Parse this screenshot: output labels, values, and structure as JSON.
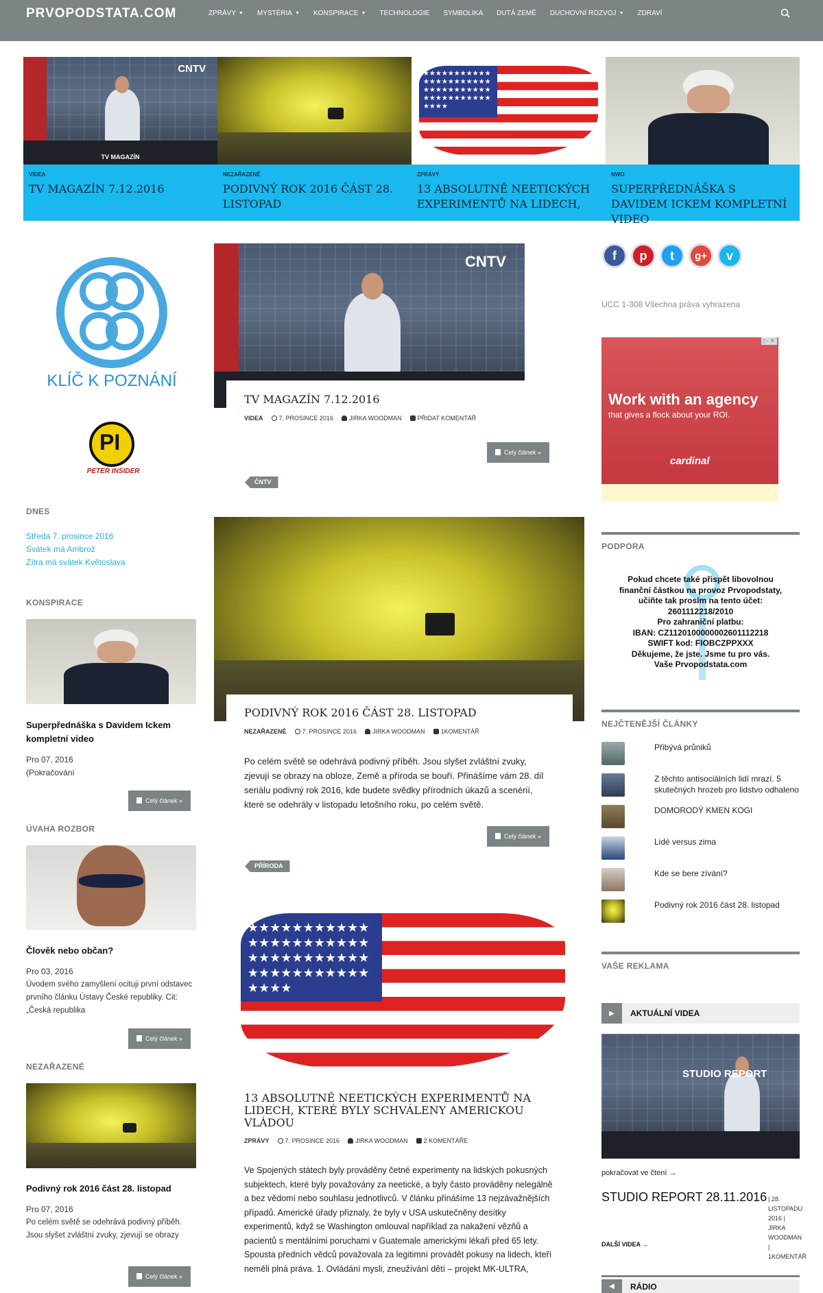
{
  "header": {
    "logo": "PRVOPODSTATA.COM",
    "nav": [
      {
        "label": "ZPRÁVY",
        "dropdown": true
      },
      {
        "label": "MYSTÉRIA",
        "dropdown": true
      },
      {
        "label": "KONSPIRACE",
        "dropdown": true
      },
      {
        "label": "TECHNOLOGIE",
        "dropdown": false
      },
      {
        "label": "SYMBOLIKA",
        "dropdown": false
      },
      {
        "label": "DUTÁ ZEMĚ",
        "dropdown": false
      },
      {
        "label": "DUCHOVNÍ ROZVOJ",
        "dropdown": true
      },
      {
        "label": "ZDRAVÍ",
        "dropdown": false
      }
    ],
    "search_icon": "search-icon",
    "bg_color": "#7c8485"
  },
  "featured": [
    {
      "category": "VIDEA",
      "title": "TV MAGAZÍN 7.12.2016",
      "image_caption": "TV MAGAZÍN",
      "brand": "CNTV"
    },
    {
      "category": "NEZAŘAZENÉ",
      "title": "PODIVNÝ ROK 2016 ČÁST 28. LISTOPAD"
    },
    {
      "category": "ZPRÁVY",
      "title": "13 ABSOLUTNĚ NEETICKÝCH EXPERIMENTŮ NA LIDECH,"
    },
    {
      "category": "NWO",
      "title": "SUPERPŘEDNÁŠKA S DAVIDEM ICKEM KOMPLETNÍ VIDEO"
    }
  ],
  "featured_color": "#19b8ee",
  "left": {
    "klic_logo_text": "KLÍČ K POZNÁNÍ",
    "peter_insider_text": "PETER INSIDER",
    "today": {
      "heading": "DNES",
      "lines": [
        "Středa 7. prosince 2016",
        "Svátek má Ambrož",
        "Zítra má svátek Květoslava"
      ]
    },
    "sections": [
      {
        "heading": "KONSPIRACE",
        "title": "Superpřednáška s Davidem Ickem kompletní video",
        "date": "Pro 07, 2016",
        "excerpt": "(Pokračování",
        "button": "Celý článek »"
      },
      {
        "heading": "ÚVAHA ROZBOR",
        "title": "Člověk nebo občan?",
        "date": "Pro 03, 2016",
        "excerpt": "Úvodem svého zamyšlení ocituji první odstavec prvního článku Ústavy České republiky. Cit: „Česká republika",
        "button": "Celý článek »"
      },
      {
        "heading": "NEZAŘAZENÉ",
        "title": "Podivný rok 2016 část 28. listopad",
        "date": "Pro 07, 2016",
        "excerpt": "Po celém světě se odehrává podivný příběh. Jsou slyšet zvláštní zvuky, zjevují se obrazy",
        "button": "Celý článek »"
      }
    ]
  },
  "posts": [
    {
      "title": "TV MAGAZÍN 7.12.2016",
      "category": "VIDEA",
      "date": "7. PROSINCE 2016",
      "author": "JIRKA WOODMAN",
      "comments": "PŘIDAT KOMENTÁŘ",
      "excerpt": "",
      "button": "Celý článek »",
      "tag": "ČNTV",
      "brand": "CNTV"
    },
    {
      "title": "PODIVNÝ ROK 2016 ČÁST 28. LISTOPAD",
      "category": "NEZAŘAZENÉ",
      "date": "7. PROSINCE 2016",
      "author": "JIRKA WOODMAN",
      "comments": "1KOMENTÁŘ",
      "excerpt": "Po celém světě se odehrává podivný příběh. Jsou slyšet zvláštní zvuky, zjevují se obrazy na obloze, Země a příroda se bouří. Přinášíme vám 28. díl seriálu podivný rok 2016, kde budete svědky přírodních úkazů a scenérií, které se odehrály v listopadu letošního roku, po celém světě.",
      "button": "Celý článek »",
      "tag": "PŘÍRODA"
    },
    {
      "title": "13 ABSOLUTNĚ NEETICKÝCH EXPERIMENTŮ NA LIDECH, KTERÉ BYLY SCHVÁLENY AMERICKOU VLÁDOU",
      "category": "ZPRÁVY",
      "date": "7. PROSINCE 2016",
      "author": "JIRKA WOODMAN",
      "comments": "2 KOMENTÁŘE",
      "excerpt": "Ve Spojených státech byly prováděny četné experimenty na lidských pokusných subjektech, které byly považovány za neetické, a byly často prováděny nelegálně a bez vědomí nebo souhlasu jednotlivců. V článku přinášíme 13 nejzávažnějších případů. Americké úřady přiznaly, že byly v USA uskutečněny desítky experimentů, když se Washington omlouval například za nakažení vězňů a pacientů s mentálními poruchami v Guatemale americkými lékaři před 65 lety. Spousta předních vědců považovala za legitimní provádět pokusy na lidech, kteří neměli plná práva. 1. Ovládání mysli, zneužívání dětí – projekt MK-ULTRA,"
    }
  ],
  "right": {
    "social": [
      {
        "icon": "facebook-icon",
        "glyph": "f",
        "color": "#3b5998"
      },
      {
        "icon": "pinterest-icon",
        "glyph": "p",
        "color": "#cb2027"
      },
      {
        "icon": "twitter-icon",
        "glyph": "t",
        "color": "#1da1f2"
      },
      {
        "icon": "googleplus-icon",
        "glyph": "g+",
        "color": "#dd4b39"
      },
      {
        "icon": "vimeo-icon",
        "glyph": "v",
        "color": "#1ab7ea"
      }
    ],
    "ucc": "UCC 1-308 Všechna práva vyhrazena",
    "ad": {
      "headline": "Work with an agency",
      "sub": "that gives a flock about your ROI.",
      "brand": "cardinal",
      "choice": "▷ ✕"
    },
    "support": {
      "heading": "PODPORA",
      "lines": [
        "Pokud chcete také přispět libovolnou",
        "finanční částkou na provoz Prvopodstaty,",
        "učiňte tak prosím na tento účet:",
        "2601112218/2010",
        "Pro zahraniční platbu:",
        "IBAN: CZ1120100000002601112218",
        "SWIFT kod: FIOBCZPPXXX",
        "Děkujeme, že jste. Jsme tu pro vás.",
        "Vaše Prvopodstata.com"
      ]
    },
    "popular": {
      "heading": "NEJČTENĚJŠÍ ČLÁNKY",
      "items": [
        "Přibývá průniků",
        "Z těchto antisociálních lidí mrazí. 5 skutečných hrozeb pro lidstvo odhaleno",
        "DOMORODÝ KMEN KOGI",
        "Lidé versus zima",
        "Kde se bere zívání?",
        "Podivný rok 2016 část 28. listopad"
      ]
    },
    "ads_heading": "VAŠE REKLAMA",
    "videos": {
      "heading": "AKTUÁLNÍ VIDEA",
      "image_text": "STUDIO REPORT",
      "continue": "pokračovat ve čtení →",
      "title": "STUDIO REPORT 28.11.2016",
      "meta": "| 28. LISTOPADU 2016 | JIRKA WOODMAN | 1KOMENTÁŘ",
      "more": "DALŠÍ VIDEA →"
    },
    "radio_heading": "RÁDIO"
  }
}
